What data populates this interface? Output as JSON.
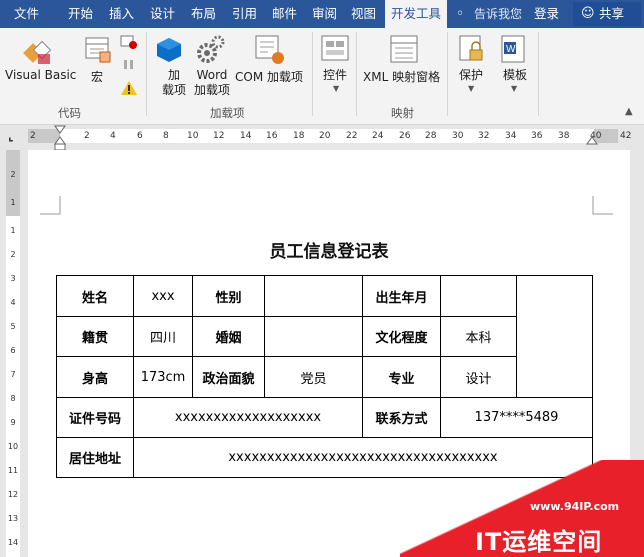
{
  "menu": {
    "tabs": [
      "文件",
      "开始",
      "插入",
      "设计",
      "布局",
      "引用",
      "邮件",
      "审阅",
      "视图",
      "开发工具"
    ],
    "active_tab": "开发工具",
    "tell_me": "告诉我您",
    "login": "登录",
    "share": "共享"
  },
  "ribbon": {
    "groups": [
      {
        "name": "代码",
        "items": [
          "Visual Basic",
          "宏"
        ]
      },
      {
        "name": "加载项",
        "items": [
          "加\n载项",
          "Word\n加载项",
          "COM 加载项"
        ]
      },
      {
        "name": "",
        "items": [
          "控件"
        ]
      },
      {
        "name": "映射",
        "items": [
          "XML 映射窗格"
        ]
      },
      {
        "name": "",
        "items": [
          "保护",
          "模板"
        ]
      }
    ]
  },
  "ruler": {
    "ticks": [
      "2",
      "2",
      "4",
      "6",
      "8",
      "10",
      "12",
      "14",
      "16",
      "18",
      "20",
      "22",
      "24",
      "26",
      "28",
      "30",
      "32",
      "34",
      "36",
      "38",
      "40",
      "42"
    ],
    "vticks": [
      "2",
      "1",
      "1",
      "2",
      "3",
      "4",
      "5",
      "6",
      "7",
      "8",
      "9",
      "10",
      "11",
      "12",
      "13",
      "14"
    ]
  },
  "document": {
    "title": "员工信息登记表",
    "rows": {
      "r1": [
        "姓名",
        "xxx",
        "性别",
        "",
        "出生年月",
        "",
        ""
      ],
      "r2": [
        "籍贯",
        "四川",
        "婚姻",
        "",
        "文化程度",
        "本科"
      ],
      "r3": [
        "身高",
        "173cm",
        "政治面貌",
        "党员",
        "专业",
        "设计"
      ],
      "r4": [
        "证件号码",
        "xxxxxxxxxxxxxxxxxxx",
        "联系方式",
        "137****5489"
      ],
      "r5": [
        "居住地址",
        "xxxxxxxxxxxxxxxxxxxxxxxxxxxxxxxxxxx"
      ]
    }
  },
  "watermark": {
    "url": "www.94IP.com",
    "name": "IT运维空间"
  },
  "colors": {
    "titlebar": "#2b579a",
    "ribbon": "#f3f3f3",
    "watermark": "#e8202a"
  }
}
